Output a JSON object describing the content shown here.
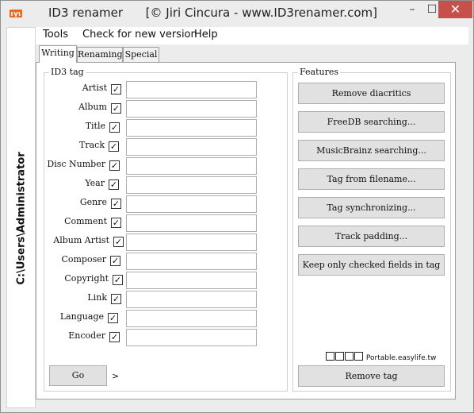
{
  "window": {
    "title": "ID3 renamer",
    "subtitle": "[© Jiri Cincura - www.ID3renamer.com]",
    "controls": {
      "minimize": "–",
      "maximize": "☐",
      "close": "✕"
    }
  },
  "sidebar": {
    "path": "C:\\Users\\Administrator"
  },
  "menu": [
    "Tools",
    "Check for new version",
    "Help"
  ],
  "tabs": [
    "Writing",
    "Renaming",
    "Special"
  ],
  "id3_group": {
    "title": "ID3 tag",
    "fields": [
      {
        "label": "Artist",
        "checked": true,
        "value": ""
      },
      {
        "label": "Album",
        "checked": true,
        "value": ""
      },
      {
        "label": "Title",
        "checked": true,
        "value": ""
      },
      {
        "label": "Track",
        "checked": true,
        "value": ""
      },
      {
        "label": "Disc Number",
        "checked": true,
        "value": ""
      },
      {
        "label": "Year",
        "checked": true,
        "value": ""
      },
      {
        "label": "Genre",
        "checked": true,
        "value": ""
      },
      {
        "label": "Comment",
        "checked": true,
        "value": ""
      },
      {
        "label": "Album Artist",
        "checked": true,
        "value": ""
      },
      {
        "label": "Composer",
        "checked": true,
        "value": ""
      },
      {
        "label": "Copyright",
        "checked": true,
        "value": ""
      },
      {
        "label": "Link",
        "checked": true,
        "value": ""
      },
      {
        "label": "Language",
        "checked": true,
        "value": ""
      },
      {
        "label": "Encoder",
        "checked": true,
        "value": ""
      }
    ],
    "go_label": "Go",
    "more_label": ">"
  },
  "features_group": {
    "title": "Features",
    "buttons": [
      "Remove diacritics",
      "FreeDB searching...",
      "MusicBrainz searching...",
      "Tag from filename...",
      "Tag synchronizing...",
      "Track padding...",
      "Keep only checked fields in tag"
    ],
    "remove_tag_label": "Remove tag"
  },
  "watermark": {
    "text": "Portable.easylife.tw"
  },
  "colors": {
    "close_button": "#c7504d",
    "window_bg": "#ececec",
    "tab_body": "#ffffff"
  }
}
